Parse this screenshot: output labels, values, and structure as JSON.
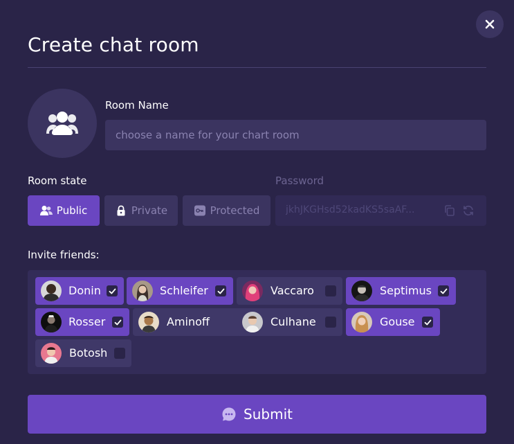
{
  "dialog": {
    "title": "Create chat room",
    "close_icon": "close-icon"
  },
  "room": {
    "avatar_icon": "group-icon",
    "name_label": "Room Name",
    "name_placeholder": "choose a name for your chart room",
    "name_value": ""
  },
  "state": {
    "label": "Room state",
    "options": [
      {
        "label": "Public",
        "icon": "users-icon",
        "selected": true
      },
      {
        "label": "Private",
        "icon": "lock-icon",
        "selected": false
      },
      {
        "label": "Protected",
        "icon": "key-icon",
        "selected": false
      }
    ]
  },
  "password": {
    "label": "Password",
    "value": "jkhJKGHsd52kadKS5saAF...",
    "copy_icon": "copy-icon",
    "refresh_icon": "refresh-icon"
  },
  "friends": {
    "label": "Invite friends:",
    "items": [
      {
        "name": "Donin",
        "selected": true
      },
      {
        "name": "Schleifer",
        "selected": true
      },
      {
        "name": "Vaccaro",
        "selected": false
      },
      {
        "name": "Septimus",
        "selected": true
      },
      {
        "name": "Rosser",
        "selected": true
      },
      {
        "name": "Aminoff",
        "selected": false
      },
      {
        "name": "Culhane",
        "selected": false
      },
      {
        "name": "Gouse",
        "selected": true
      },
      {
        "name": "Botosh",
        "selected": false
      }
    ]
  },
  "submit": {
    "label": "Submit",
    "icon": "chat-bubble-icon"
  },
  "colors": {
    "background": "#2a2448",
    "surface": "#3b3460",
    "accent": "#6a46c1"
  }
}
